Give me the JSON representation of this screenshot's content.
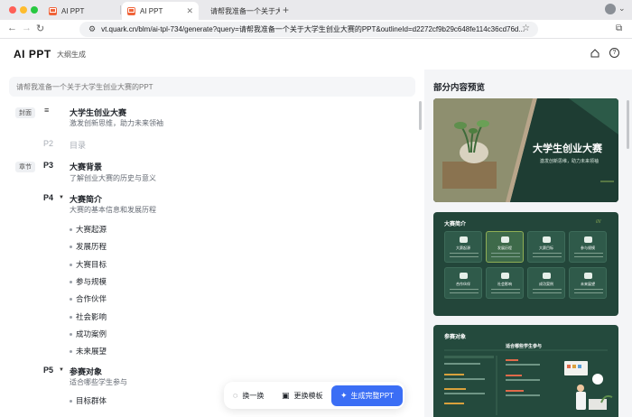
{
  "browser": {
    "tabs": [
      {
        "label": "AI PPT",
        "active": false
      },
      {
        "label": "AI PPT",
        "active": true
      },
      {
        "label": "请帮我准备一个关于大学生职...",
        "active": false
      }
    ],
    "new_tab": "+",
    "url": "vt.quark.cn/blm/ai-tpl-734/generate?query=请帮我准备一个关于大学生创业大赛的PPT&outlineId=d2272cf9b29c648fe114c36cd76d..."
  },
  "app": {
    "logo": "AI PPT",
    "subtitle": "大纲生成",
    "query_text": "请帮我准备一个关于大学生创业大赛的PPT"
  },
  "outline": {
    "cover_tag": "封面",
    "chapter_tag": "章节",
    "cover_title": "大学生创业大赛",
    "cover_desc": "激发创新思维，助力未来领袖",
    "p2": {
      "num": "P2",
      "title": "目录"
    },
    "p3": {
      "num": "P3",
      "title": "大赛背景",
      "desc": "了解创业大赛的历史与意义"
    },
    "p4": {
      "num": "P4",
      "title": "大赛简介",
      "desc": "大赛的基本信息和发展历程",
      "items": [
        "大赛起源",
        "发展历程",
        "大赛目标",
        "参与规模",
        "合作伙伴",
        "社会影响",
        "成功案例",
        "未来展望"
      ]
    },
    "p5": {
      "num": "P5",
      "title": "参赛对象",
      "desc": "适合哪些学生参与",
      "items": [
        "目标群体"
      ]
    }
  },
  "toolbar": {
    "swap_label": "换一换",
    "template_label": "更换模板",
    "generate_label": "生成完整PPT"
  },
  "preview": {
    "title": "部分内容预览",
    "slide1": {
      "title": "大学生创业大赛",
      "subtitle": "激发创新思维，助力未来领袖"
    },
    "slide2": {
      "title": "大赛简介",
      "cards": [
        "大赛起源",
        "发展历程",
        "大赛目标",
        "参与规模",
        "合作伙伴",
        "社会影响",
        "成功案例",
        "未来展望"
      ]
    },
    "slide3": {
      "title": "参赛对象",
      "heading": "适合哪些学生参与"
    }
  },
  "colors": {
    "accent": "#3b6ef5",
    "slide_green": "#1e3d33",
    "highlight": "#8fae55"
  }
}
